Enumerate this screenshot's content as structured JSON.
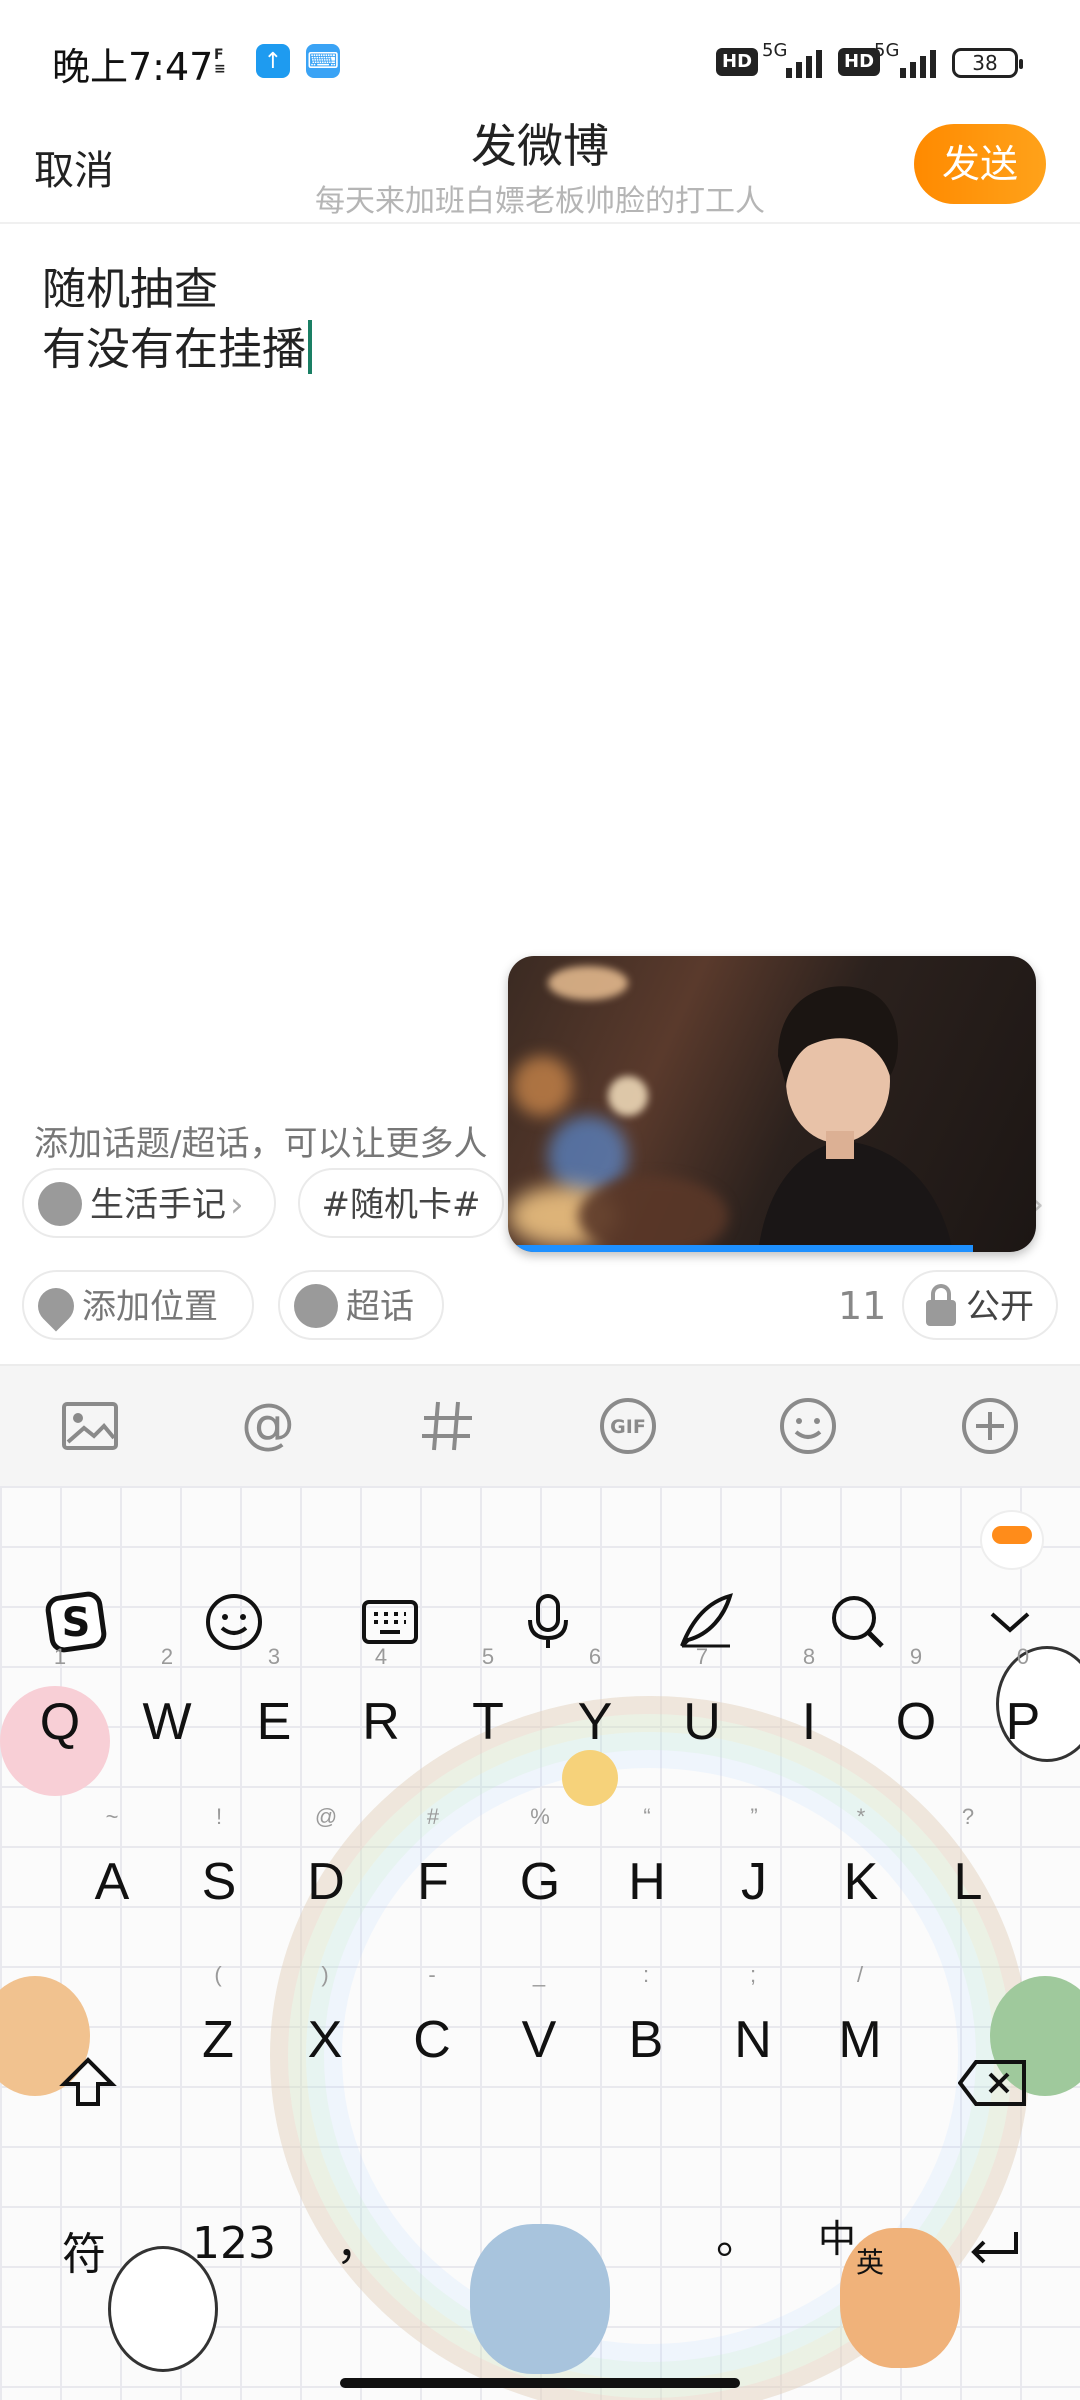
{
  "status_bar": {
    "time": "晚上7:47",
    "hd1": "HD",
    "net1": "5G",
    "hd2": "HD",
    "net2": "5G",
    "battery": "38"
  },
  "header": {
    "cancel_label": "取消",
    "title": "发微博",
    "subtitle": "每天来加班白嫖老板帅脸的打工人",
    "send_label": "发送"
  },
  "editor": {
    "line1": "随机抽查",
    "line2": "有没有在挂播"
  },
  "topics": {
    "hint": "添加话题/超话，可以让更多人",
    "chips": [
      "生活手记",
      "#随机卡#"
    ],
    "location_label": "添加位置",
    "super_label": "超话",
    "count": "11",
    "visibility_label": "公开"
  },
  "video": {
    "progress": 0.88
  },
  "toolbar": {
    "icons": [
      "image-icon",
      "at-icon",
      "hashtag-icon",
      "gif-icon",
      "emoji-icon",
      "add-icon"
    ],
    "gif_text": "GIF"
  },
  "keyboard": {
    "row1": [
      "Q",
      "W",
      "E",
      "R",
      "T",
      "Y",
      "U",
      "I",
      "O",
      "P"
    ],
    "row1_hints": [
      "1",
      "2",
      "3",
      "4",
      "5",
      "6",
      "7",
      "8",
      "9",
      "0"
    ],
    "row2": [
      "A",
      "S",
      "D",
      "F",
      "G",
      "H",
      "J",
      "K",
      "L"
    ],
    "row2_hints": [
      "~",
      "!",
      "@",
      "#",
      "%",
      "“",
      "”",
      "*",
      "?"
    ],
    "row3": [
      "Z",
      "X",
      "C",
      "V",
      "B",
      "N",
      "M"
    ],
    "row3_hints": [
      "(",
      ")",
      "-",
      "_",
      ":",
      ";",
      "/"
    ],
    "bottom": {
      "symbols": "符",
      "numbers": "123",
      "comma": "，",
      "period": "。",
      "lang_zh": "中",
      "lang_en": "英"
    }
  },
  "colors": {
    "send_bg": "#ff9a0c",
    "cursor": "#1a7f64",
    "video_progress": "#1e90ff"
  }
}
